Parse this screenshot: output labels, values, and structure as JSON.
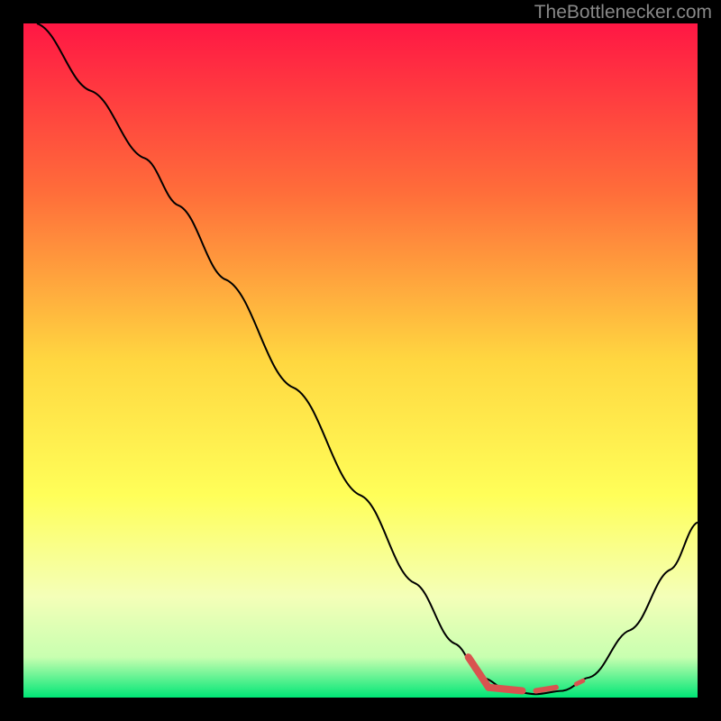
{
  "watermark": "TheBottlenecker.com",
  "chart_data": {
    "type": "line",
    "title": "",
    "xlabel": "",
    "ylabel": "",
    "xlim": [
      0,
      100
    ],
    "ylim": [
      0,
      100
    ],
    "gradient_stops": [
      {
        "offset": 0,
        "color": "#ff1744"
      },
      {
        "offset": 25,
        "color": "#ff6d3a"
      },
      {
        "offset": 50,
        "color": "#ffd740"
      },
      {
        "offset": 70,
        "color": "#ffff59"
      },
      {
        "offset": 85,
        "color": "#f4ffb8"
      },
      {
        "offset": 94,
        "color": "#c8ffb0"
      },
      {
        "offset": 100,
        "color": "#00e676"
      }
    ],
    "series": [
      {
        "name": "bottleneck-curve",
        "type": "line",
        "color": "#000000",
        "width": 2,
        "points": [
          {
            "x": 2,
            "y": 100
          },
          {
            "x": 10,
            "y": 90
          },
          {
            "x": 18,
            "y": 80
          },
          {
            "x": 23,
            "y": 73
          },
          {
            "x": 30,
            "y": 62
          },
          {
            "x": 40,
            "y": 46
          },
          {
            "x": 50,
            "y": 30
          },
          {
            "x": 58,
            "y": 17
          },
          {
            "x": 64,
            "y": 8
          },
          {
            "x": 68,
            "y": 3
          },
          {
            "x": 72,
            "y": 1
          },
          {
            "x": 76,
            "y": 0.5
          },
          {
            "x": 80,
            "y": 1
          },
          {
            "x": 84,
            "y": 3
          },
          {
            "x": 90,
            "y": 10
          },
          {
            "x": 96,
            "y": 19
          },
          {
            "x": 100,
            "y": 26
          }
        ]
      },
      {
        "name": "optimal-range-marker",
        "type": "marker",
        "color": "#d9534f",
        "segments": [
          {
            "x1": 66,
            "y1": 6,
            "x2": 69,
            "y2": 1.5,
            "w": 8
          },
          {
            "x1": 69,
            "y1": 1.5,
            "x2": 74,
            "y2": 1,
            "w": 8
          },
          {
            "x1": 76,
            "y1": 1,
            "x2": 79,
            "y2": 1.5,
            "w": 6
          },
          {
            "x1": 82,
            "y1": 2,
            "x2": 83,
            "y2": 2.5,
            "w": 5
          }
        ]
      }
    ]
  }
}
